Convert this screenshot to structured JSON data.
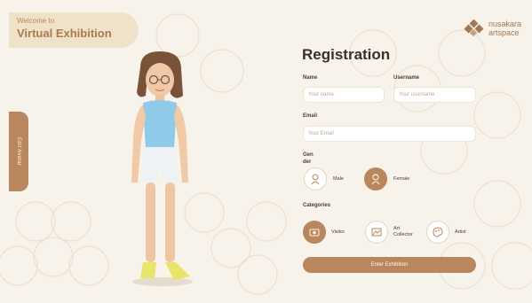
{
  "header": {
    "welcome_small": "Welcome to",
    "welcome_big": "Virtual Exhibition",
    "brand_line1": "nusakara",
    "brand_line2": "artspace"
  },
  "side_tab": {
    "label": "Edit Avatar"
  },
  "form": {
    "title": "Registration",
    "name_label": "Name",
    "name_placeholder": "Your name",
    "username_label": "Username",
    "username_placeholder": "Your username",
    "email_label": "Email",
    "email_placeholder": "Your Email",
    "gender_label_1": "Gen",
    "gender_label_2": "der",
    "gender_options": [
      {
        "label": "Male",
        "icon": "male-icon",
        "selected": false
      },
      {
        "label": "Female",
        "icon": "female-icon",
        "selected": true
      }
    ],
    "categories_label": "Categories",
    "category_options": [
      {
        "label": "Visitor",
        "icon": "visitor-icon",
        "selected": true
      },
      {
        "label_1": "Art",
        "label_2": "Collector",
        "icon": "collector-icon",
        "selected": false
      },
      {
        "label": "Artist",
        "icon": "artist-icon",
        "selected": false
      }
    ],
    "submit_label": "Enter Exhibition"
  },
  "colors": {
    "accent": "#b9875e",
    "background": "#f7f2ea",
    "welcome_bg": "#efe2c9"
  }
}
